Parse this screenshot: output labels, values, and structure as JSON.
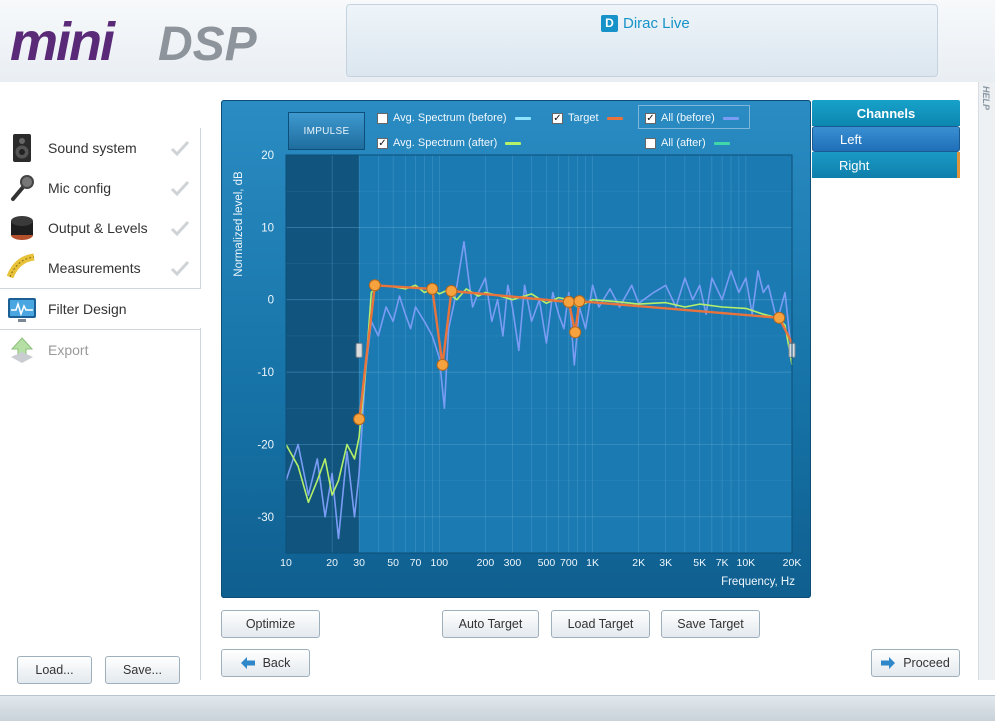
{
  "header": {
    "logo_text": "miniDSP",
    "product": "Dirac Live"
  },
  "sidebar": {
    "steps": [
      {
        "label": "Sound system",
        "icon": "speaker-icon",
        "state": "done"
      },
      {
        "label": "Mic config",
        "icon": "microphone-icon",
        "state": "done"
      },
      {
        "label": "Output & Levels",
        "icon": "knob-icon",
        "state": "done"
      },
      {
        "label": "Measurements",
        "icon": "tape-measure-icon",
        "state": "done"
      },
      {
        "label": "Filter Design",
        "icon": "monitor-waveform-icon",
        "state": "active"
      },
      {
        "label": "Export",
        "icon": "export-arrow-icon",
        "state": "disabled"
      }
    ]
  },
  "buttons": {
    "load": "Load...",
    "save": "Save...",
    "optimize": "Optimize",
    "auto_target": "Auto Target",
    "load_target": "Load Target",
    "save_target": "Save Target",
    "back": "Back",
    "proceed": "Proceed",
    "impulse": "IMPULSE"
  },
  "legend": {
    "avg_before": {
      "label": "Avg. Spectrum (before)",
      "checked": false,
      "color": "#8fe3ff"
    },
    "avg_after": {
      "label": "Avg. Spectrum (after)",
      "checked": true,
      "color": "#b4f06a"
    },
    "target": {
      "label": "Target",
      "checked": true,
      "color": "#e8733c"
    },
    "all_before": {
      "label": "All (before)",
      "checked": true,
      "color": "#7a9cf5"
    },
    "all_after": {
      "label": "All (after)",
      "checked": false,
      "color": "#3fd6a8"
    }
  },
  "channels": {
    "title": "Channels",
    "items": [
      "Left",
      "Right"
    ],
    "selected": "Left"
  },
  "help_label": "HELP",
  "chart_data": {
    "type": "line",
    "xlabel": "Frequency, Hz",
    "ylabel": "Normalized level, dB",
    "x_scale": "log",
    "xlim": [
      10,
      20000
    ],
    "ylim": [
      -35,
      20
    ],
    "x_ticks": [
      {
        "v": 10,
        "l": "10"
      },
      {
        "v": 20,
        "l": "20"
      },
      {
        "v": 30,
        "l": "30"
      },
      {
        "v": 50,
        "l": "50"
      },
      {
        "v": 70,
        "l": "70"
      },
      {
        "v": 100,
        "l": "100"
      },
      {
        "v": 200,
        "l": "200"
      },
      {
        "v": 300,
        "l": "300"
      },
      {
        "v": 500,
        "l": "500"
      },
      {
        "v": 700,
        "l": "700"
      },
      {
        "v": 1000,
        "l": "1K"
      },
      {
        "v": 2000,
        "l": "2K"
      },
      {
        "v": 3000,
        "l": "3K"
      },
      {
        "v": 5000,
        "l": "5K"
      },
      {
        "v": 7000,
        "l": "7K"
      },
      {
        "v": 10000,
        "l": "10K"
      },
      {
        "v": 20000,
        "l": "20K"
      }
    ],
    "y_ticks": [
      {
        "v": 20,
        "l": "20"
      },
      {
        "v": 10,
        "l": "10"
      },
      {
        "v": 0,
        "l": "0"
      },
      {
        "v": -10,
        "l": "-10"
      },
      {
        "v": -20,
        "l": "-20"
      },
      {
        "v": -30,
        "l": "-30"
      }
    ],
    "excluded_below_hz": 30,
    "series": [
      {
        "name": "Target",
        "color": "#e8733c",
        "points": [
          [
            30,
            -17
          ],
          [
            33,
            -9
          ],
          [
            38,
            2
          ],
          [
            90,
            1.5
          ],
          [
            105,
            -9
          ],
          [
            120,
            1.2
          ],
          [
            700,
            -0.3
          ],
          [
            770,
            -4.5
          ],
          [
            820,
            -0.2
          ],
          [
            16500,
            -2.5
          ],
          [
            20000,
            -6
          ]
        ],
        "handles": [
          [
            30,
            -16.5
          ],
          [
            38,
            2
          ],
          [
            90,
            1.5
          ],
          [
            105,
            -9
          ],
          [
            120,
            1.2
          ],
          [
            700,
            -0.3
          ],
          [
            770,
            -4.5
          ],
          [
            820,
            -0.2
          ],
          [
            16500,
            -2.5
          ]
        ]
      },
      {
        "name": "All (before)",
        "color": "#7a9cf5",
        "points": [
          [
            10,
            -25
          ],
          [
            12,
            -20
          ],
          [
            14,
            -27
          ],
          [
            16,
            -22
          ],
          [
            18,
            -30
          ],
          [
            20,
            -24
          ],
          [
            22,
            -33
          ],
          [
            25,
            -21
          ],
          [
            28,
            -30
          ],
          [
            30,
            -24
          ],
          [
            33,
            -10
          ],
          [
            36,
            -3
          ],
          [
            40,
            -5
          ],
          [
            45,
            -1
          ],
          [
            50,
            -3
          ],
          [
            55,
            0.5
          ],
          [
            60,
            -2
          ],
          [
            65,
            -4
          ],
          [
            70,
            -1
          ],
          [
            80,
            -3
          ],
          [
            90,
            -5
          ],
          [
            100,
            -8
          ],
          [
            108,
            -15
          ],
          [
            115,
            -4
          ],
          [
            125,
            -0.5
          ],
          [
            135,
            4
          ],
          [
            145,
            8
          ],
          [
            155,
            3
          ],
          [
            165,
            -1
          ],
          [
            180,
            1
          ],
          [
            200,
            3
          ],
          [
            220,
            -3
          ],
          [
            240,
            0
          ],
          [
            260,
            -5
          ],
          [
            280,
            2
          ],
          [
            300,
            -1
          ],
          [
            330,
            -7
          ],
          [
            360,
            2
          ],
          [
            400,
            -3
          ],
          [
            450,
            0
          ],
          [
            500,
            -6
          ],
          [
            550,
            1
          ],
          [
            600,
            -2
          ],
          [
            650,
            -4
          ],
          [
            700,
            1
          ],
          [
            760,
            -9
          ],
          [
            820,
            -1
          ],
          [
            900,
            -4
          ],
          [
            1000,
            2
          ],
          [
            1100,
            -1
          ],
          [
            1300,
            1.5
          ],
          [
            1500,
            -1
          ],
          [
            1800,
            2
          ],
          [
            2000,
            -0.5
          ],
          [
            2500,
            1
          ],
          [
            3000,
            2
          ],
          [
            3500,
            -1
          ],
          [
            4000,
            3
          ],
          [
            4500,
            0
          ],
          [
            5000,
            2
          ],
          [
            5500,
            -2
          ],
          [
            6000,
            3
          ],
          [
            7000,
            0
          ],
          [
            8000,
            4
          ],
          [
            9000,
            1
          ],
          [
            10000,
            3
          ],
          [
            11000,
            -2
          ],
          [
            12000,
            4
          ],
          [
            13000,
            1
          ],
          [
            14000,
            2
          ],
          [
            16000,
            -3
          ],
          [
            18000,
            1
          ],
          [
            20000,
            -8
          ]
        ]
      },
      {
        "name": "Avg. Spectrum (after)",
        "color": "#b4f06a",
        "points": [
          [
            10,
            -20
          ],
          [
            12,
            -23
          ],
          [
            14,
            -28
          ],
          [
            16,
            -25
          ],
          [
            18,
            -22
          ],
          [
            20,
            -27
          ],
          [
            22,
            -25
          ],
          [
            25,
            -20
          ],
          [
            28,
            -22
          ],
          [
            30,
            -19
          ],
          [
            33,
            -10
          ],
          [
            36,
            1
          ],
          [
            40,
            2
          ],
          [
            50,
            1.8
          ],
          [
            60,
            1.5
          ],
          [
            70,
            2
          ],
          [
            80,
            1
          ],
          [
            90,
            1.5
          ],
          [
            100,
            0.8
          ],
          [
            110,
            1.2
          ],
          [
            130,
            0
          ],
          [
            150,
            1.5
          ],
          [
            180,
            0.5
          ],
          [
            200,
            1
          ],
          [
            250,
            0.5
          ],
          [
            300,
            0
          ],
          [
            400,
            0.8
          ],
          [
            500,
            -0.5
          ],
          [
            600,
            0.3
          ],
          [
            700,
            0
          ],
          [
            800,
            -1
          ],
          [
            1000,
            0
          ],
          [
            1500,
            -0.3
          ],
          [
            2000,
            -0.6
          ],
          [
            3000,
            -0.4
          ],
          [
            4000,
            -1
          ],
          [
            5000,
            -0.6
          ],
          [
            7000,
            -1
          ],
          [
            10000,
            -1.2
          ],
          [
            13000,
            -2
          ],
          [
            16000,
            -2.5
          ],
          [
            18000,
            -3.5
          ],
          [
            20000,
            -9
          ]
        ]
      }
    ]
  }
}
